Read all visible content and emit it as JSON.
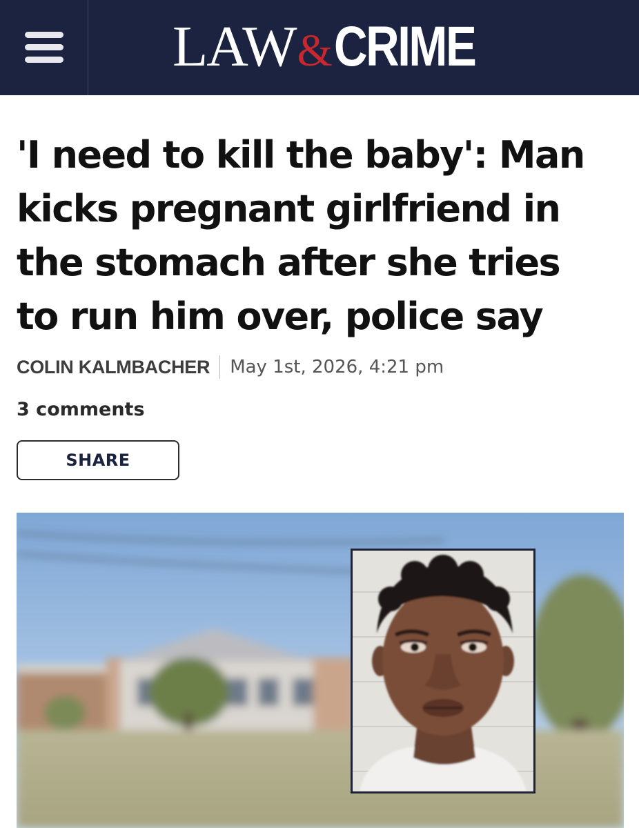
{
  "header": {
    "logo": {
      "part1": "LAW",
      "ampersand": "&",
      "part2": "CRIME"
    },
    "menu_icon": "hamburger-menu-icon",
    "background_color": "#1b2340",
    "accent_color": "#c8282d"
  },
  "article": {
    "headline_lines": [
      "'I need to kill the baby': Man",
      "kicks pregnant girlfriend in",
      "the stomach after she tries",
      "to run him over, police say"
    ],
    "author": "COLIN KALMBACHER",
    "date": "May 1st, 2026, 4:21 pm",
    "comments_label": "3 comments",
    "share_label": "SHARE"
  },
  "hero_image": {
    "scene": "blurred building with lawn and trees",
    "inset": "mugshot photo"
  }
}
